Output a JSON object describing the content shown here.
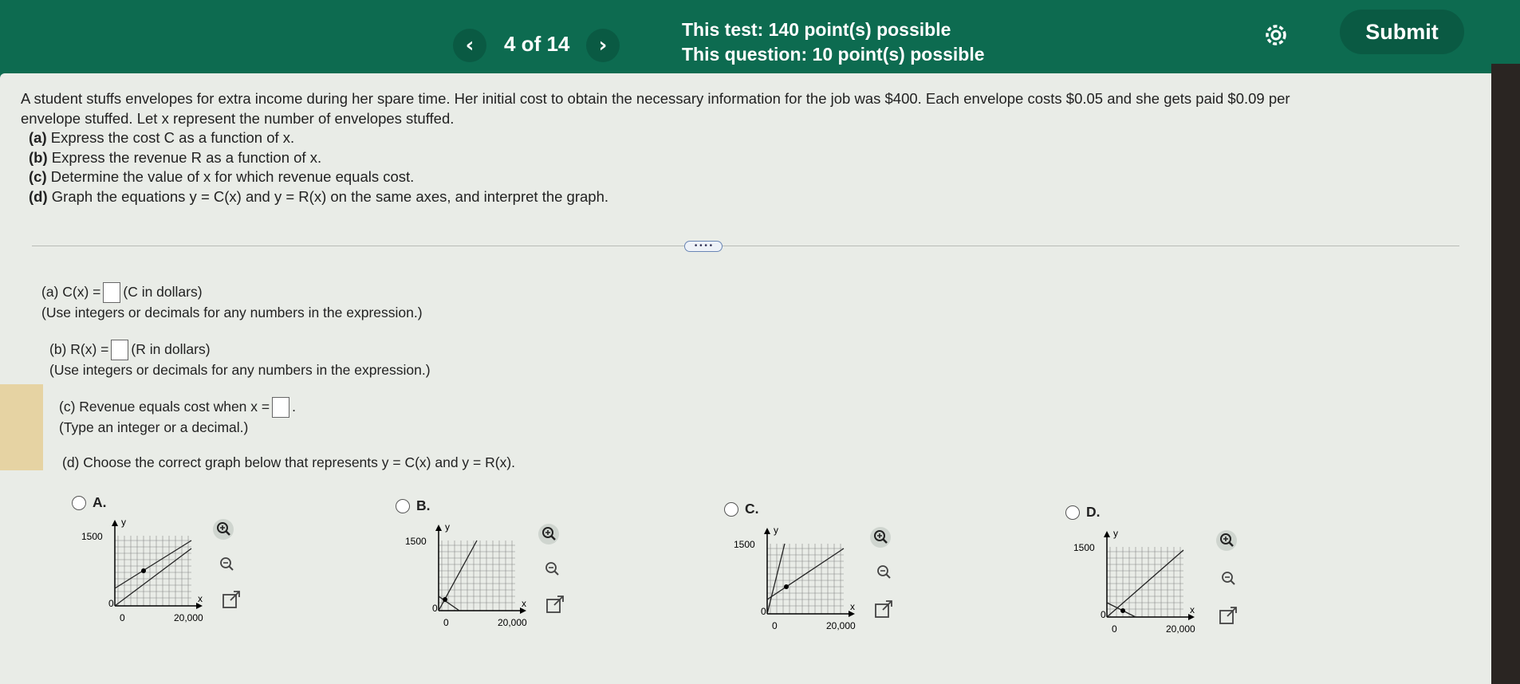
{
  "header": {
    "counter": "4 of 14",
    "test_points": "This test: 140 point(s) possible",
    "question_points": "This question: 10 point(s) possible",
    "submit_label": "Submit"
  },
  "question": {
    "line1": "A student stuffs envelopes for extra income during her spare time. Her initial cost to obtain the necessary information for the job was $400. Each envelope costs $0.05 and she gets paid $0.09 per",
    "line2": "envelope stuffed. Let x represent the number of envelopes stuffed.",
    "a_bold": "(a)",
    "a": "Express the cost C as a function of x.",
    "b_bold": "(b)",
    "b": "Express the revenue R as a function of x.",
    "c_bold": "(c)",
    "c": "Determine the value of x for which revenue equals cost.",
    "d_bold": "(d)",
    "d": "Graph the equations y = C(x) and y = R(x) on the same axes, and interpret the graph."
  },
  "more_label": "• • • •",
  "answers": {
    "a_pre": "(a) C(x) =",
    "a_post": "(C in dollars)",
    "a_hint": "(Use integers or decimals for any numbers in the expression.)",
    "b_pre": "(b) R(x) =",
    "b_post": "(R in dollars)",
    "b_hint": "(Use integers or decimals for any numbers in the expression.)",
    "c_pre": "(c) Revenue equals cost when x =",
    "c_post": ".",
    "c_hint": "(Type an integer or a decimal.)",
    "d_text": "(d) Choose the correct graph below that represents y = C(x) and y = R(x)."
  },
  "options": [
    {
      "letter": "A.",
      "ytick": "1500",
      "y0": "0",
      "x0": "0",
      "xtick": "20,000",
      "xlabel": "x",
      "ylabel": "y"
    },
    {
      "letter": "B.",
      "ytick": "1500",
      "y0": "0",
      "x0": "0",
      "xtick": "20,000",
      "xlabel": "x",
      "ylabel": "y"
    },
    {
      "letter": "C.",
      "ytick": "1500",
      "y0": "0",
      "x0": "0",
      "xtick": "20,000",
      "xlabel": "x",
      "ylabel": "y"
    },
    {
      "letter": "D.",
      "ytick": "1500",
      "y0": "0",
      "x0": "0",
      "xtick": "20,000",
      "xlabel": "x",
      "ylabel": "y"
    }
  ]
}
